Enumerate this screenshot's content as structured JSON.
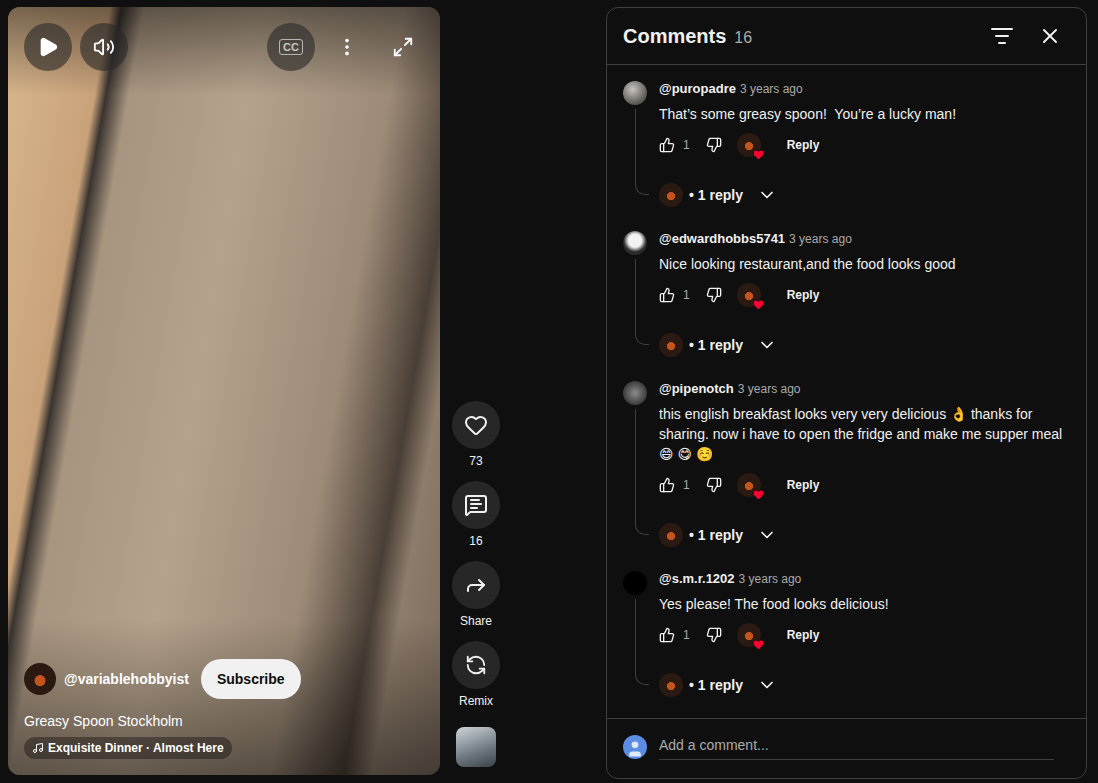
{
  "video": {
    "title": "Greasy Spoon Stockholm",
    "channel": "@variablehobbyist",
    "subscribe": "Subscribe",
    "music": "Exquisite Dinner · Almost Here",
    "captions": "CC",
    "playing": false,
    "muted": false
  },
  "actions": [
    {
      "kind": "like",
      "label": "73"
    },
    {
      "kind": "comment",
      "label": "16"
    },
    {
      "kind": "share",
      "label": "Share"
    },
    {
      "kind": "remix",
      "label": "Remix"
    }
  ],
  "comments_panel": {
    "title": "Comments",
    "count": "16",
    "placeholder": "Add a comment..."
  },
  "comments": [
    {
      "author": "@puropadre",
      "time": "3 years ago",
      "text": "That’s some greasy spoon!  You’re a lucky man!",
      "likes": "1",
      "hearted": true,
      "reply": "Reply",
      "replies": "• 1 reply"
    },
    {
      "author": "@edwardhobbs5741",
      "time": "3 years ago",
      "text": "Nice looking restaurant,and the food looks good",
      "likes": "1",
      "hearted": true,
      "reply": "Reply",
      "replies": "• 1 reply"
    },
    {
      "author": "@pipenotch",
      "time": "3 years ago",
      "text": "this english breakfast looks very very delicious 👌 thanks for sharing. now i have to open the fridge and make me supper meal 😄 😋 ☺️",
      "likes": "1",
      "hearted": true,
      "reply": "Reply",
      "replies": "• 1 reply"
    },
    {
      "author": "@s.m.r.1202",
      "time": "3 years ago",
      "text": "Yes please! The food looks delicious!",
      "likes": "1",
      "hearted": true,
      "reply": "Reply",
      "replies": "• 1 reply"
    }
  ]
}
